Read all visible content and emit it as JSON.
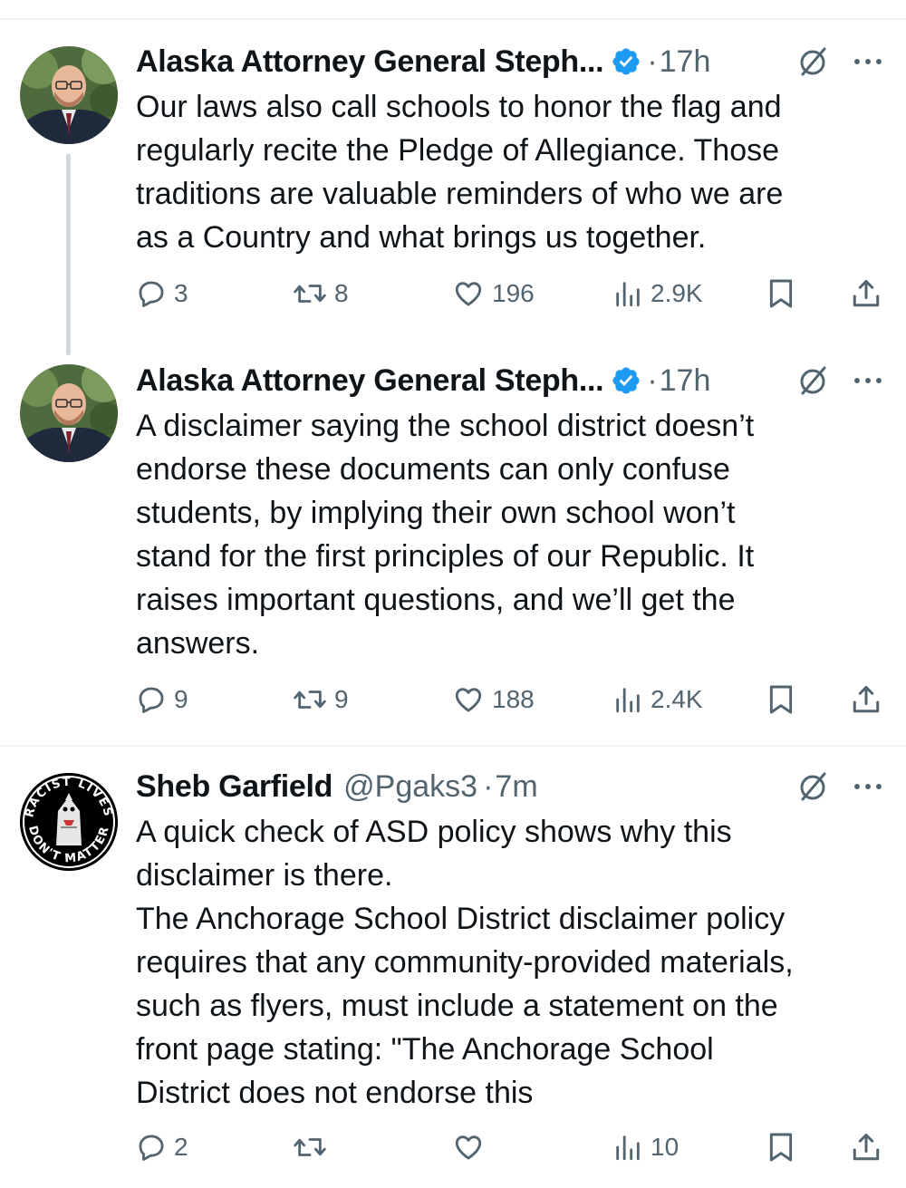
{
  "tweets": [
    {
      "author": "Alaska Attorney General Steph...",
      "handle": "",
      "separator": "·",
      "time": "17h",
      "text_lines": [
        "Our laws also call schools to honor the flag and",
        "regularly recite the Pledge of Allegiance. Those",
        "traditions are valuable reminders of who we are",
        "as a Country and what brings us together."
      ],
      "replies": "3",
      "reposts": "8",
      "likes": "196",
      "views": "2.9K",
      "verified": true,
      "avatar": "portrait-man-glasses"
    },
    {
      "author": "Alaska Attorney General Steph...",
      "handle": "",
      "separator": "·",
      "time": "17h",
      "text_lines": [
        "A disclaimer saying the school district doesn’t",
        "endorse these documents can only confuse",
        "students, by implying their own school won’t",
        "stand for the first principles of our Republic. It",
        "raises important questions, and we’ll get the",
        "answers."
      ],
      "replies": "9",
      "reposts": "9",
      "likes": "188",
      "views": "2.4K",
      "verified": true,
      "avatar": "portrait-man-glasses"
    },
    {
      "author": "Sheb Garfield",
      "handle": "@Pgaks3",
      "separator": "·",
      "time": "7m",
      "text_lines": [
        "A quick check of ASD policy shows why this",
        "disclaimer is there.",
        "The Anchorage School District disclaimer policy",
        "requires that any community-provided materials,",
        "such as flyers, must include a statement on the",
        "front page stating: \"The Anchorage School",
        "District does not endorse this"
      ],
      "replies": "2",
      "reposts": "",
      "likes": "",
      "views": "10",
      "verified": false,
      "avatar": "racist-lives-dont-matter-badge",
      "avatar_text_top": "RACIST LIVES",
      "avatar_text_bottom": "DON'T MATTER"
    }
  ],
  "colors": {
    "text": "#0f1419",
    "secondary": "#536471",
    "verified": "#1d9bf0",
    "divider": "#eff3f4",
    "thread_line": "#cfd9de"
  },
  "icons": [
    "verified-badge-icon",
    "grok-icon",
    "more-icon",
    "reply-icon",
    "repost-icon",
    "like-icon",
    "views-icon",
    "bookmark-icon",
    "share-icon"
  ]
}
